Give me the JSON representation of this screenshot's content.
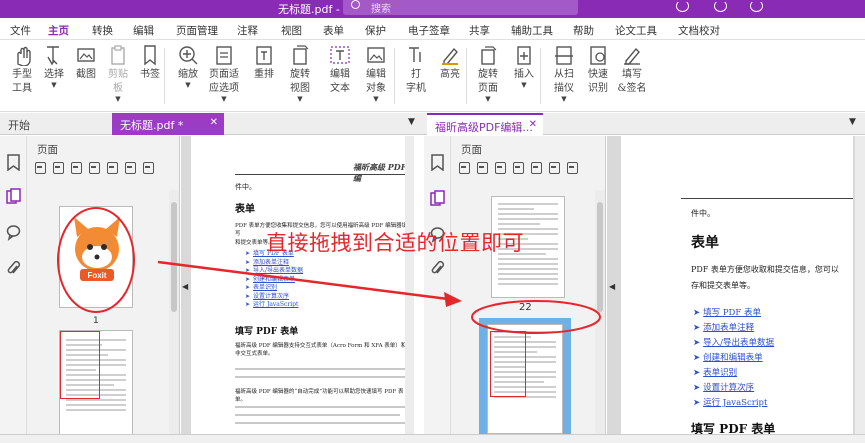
{
  "titlebar": {
    "file_title": "无标题.pdf -",
    "search_placeholder": "搜索"
  },
  "menu": {
    "items": [
      "文件",
      "主页",
      "转换",
      "编辑",
      "页面管理",
      "注释",
      "视图",
      "表单",
      "保护",
      "电子签章",
      "共享",
      "辅助工具",
      "帮助",
      "论文工具",
      "文档校对"
    ],
    "active": "主页"
  },
  "ribbon": {
    "buttons": [
      {
        "l1": "手型",
        "l2": "工具",
        "icon": "hand-icon"
      },
      {
        "l1": "选择",
        "l2": "",
        "icon": "select-text-icon",
        "caret": true
      },
      {
        "l1": "截图",
        "l2": "",
        "icon": "screenshot-icon"
      },
      {
        "l1": "剪贴",
        "l2": "板",
        "icon": "clipboard-icon",
        "caret": true,
        "disabled": true
      },
      {
        "l1": "书签",
        "l2": "",
        "icon": "bookmark-icon"
      },
      {
        "l1": "缩放",
        "l2": "",
        "icon": "zoom-icon",
        "caret": true
      },
      {
        "l1": "页面适",
        "l2": "应选项",
        "icon": "fit-page-icon",
        "caret": true
      },
      {
        "l1": "重排",
        "l2": "",
        "icon": "reflow-icon"
      },
      {
        "l1": "旋转",
        "l2": "视图",
        "icon": "rotate-view-icon",
        "caret": true
      },
      {
        "l1": "编辑",
        "l2": "文本",
        "icon": "edit-text-icon"
      },
      {
        "l1": "编辑",
        "l2": "对象",
        "icon": "edit-object-icon",
        "caret": true
      },
      {
        "l1": "打",
        "l2": "字机",
        "icon": "typewriter-icon"
      },
      {
        "l1": "高亮",
        "l2": "",
        "icon": "highlight-icon"
      },
      {
        "l1": "旋转",
        "l2": "页面",
        "icon": "rotate-page-icon",
        "caret": true
      },
      {
        "l1": "插入",
        "l2": "",
        "icon": "insert-page-icon",
        "caret": true
      },
      {
        "l1": "从扫",
        "l2": "描仪",
        "icon": "scanner-icon",
        "caret": true
      },
      {
        "l1": "快速",
        "l2": "识别",
        "icon": "ocr-icon"
      },
      {
        "l1": "填写",
        "l2": "&签名",
        "icon": "fill-sign-icon"
      }
    ]
  },
  "tabs": {
    "start": "开始",
    "doc1": "无标题.pdf *",
    "doc2": "福昕高级PDF编辑..."
  },
  "left_pane": {
    "title": "页面",
    "page_number": "1"
  },
  "right_pane": {
    "title": "页面",
    "page_number": "22"
  },
  "doc_left": {
    "header": "福昕高级 PDF 编",
    "intro": "件中。",
    "heading1": "表单",
    "para1": "PDF 表单方便您收集和提交信息，您可以使用福昕高级 PDF 编辑器填写",
    "para1b": "和提交表单等。",
    "links": [
      "填写 PDF 表单",
      "添加表单注释",
      "导入/导出表单数据",
      "创建和编辑表单",
      "表单识别",
      "设置计算次序",
      "运行 JavaScript"
    ],
    "heading2": "填写 PDF 表单",
    "para2": "福昕高级 PDF 编辑器支持交互式表单（Acro Form 和 XFA 表单）和非交互式表单。",
    "para3": "福昕高级 PDF 编辑器的“自动完成”功能可以帮助您快速填写 PDF 表单。"
  },
  "doc_right": {
    "intro": "件中。",
    "heading1": "表单",
    "para1": "PDF 表单方便您收取和提交信息，您可以",
    "para1b": "存和提交表单等。",
    "links": [
      "填写 PDF 表单",
      "添加表单注释",
      "导入/导出表单数据",
      "创建和编辑表单",
      "表单识别",
      "设置计算次序",
      "运行 JavaScript"
    ],
    "heading2": "填写 PDF 表单"
  },
  "annotation": {
    "text": "直接拖拽到合适的位置即可",
    "color": "#e5262b"
  },
  "colors": {
    "brand": "#8a2bb5",
    "link": "#2b4fd1"
  }
}
